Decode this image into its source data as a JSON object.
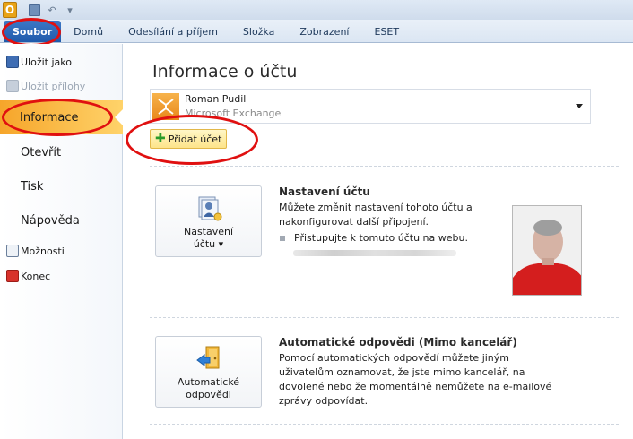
{
  "ribbon": {
    "tabs": [
      {
        "label": "Soubor"
      },
      {
        "label": "Domů"
      },
      {
        "label": "Odesílání a příjem"
      },
      {
        "label": "Složka"
      },
      {
        "label": "Zobrazení"
      },
      {
        "label": "ESET"
      }
    ]
  },
  "qat": {
    "app_icon": "outlook-icon"
  },
  "nav": {
    "items": [
      {
        "label": "Uložit jako",
        "icon": "save-as-icon"
      },
      {
        "label": "Uložit přílohy",
        "icon": "save-attachments-icon"
      },
      {
        "label": "Informace"
      },
      {
        "label": "Otevřít"
      },
      {
        "label": "Tisk"
      },
      {
        "label": "Nápověda"
      },
      {
        "label": "Možnosti",
        "icon": "options-icon"
      },
      {
        "label": "Konec",
        "icon": "exit-icon"
      }
    ]
  },
  "content": {
    "title": "Informace o účtu",
    "account": {
      "name": "Roman Pudil",
      "type": "Microsoft Exchange"
    },
    "add_account_label": "Přidat účet",
    "settings": {
      "button_line1": "Nastavení",
      "button_line2": "účtu ▾",
      "title": "Nastavení účtu",
      "text": "Můžete změnit nastavení tohoto účtu a nakonfigurovat další připojení.",
      "bullet": "Přistupujte k tomuto účtu na webu."
    },
    "auto_reply": {
      "button_line1": "Automatické",
      "button_line2": "odpovědi",
      "title": "Automatické odpovědi (Mimo kancelář)",
      "text": "Pomocí automatických odpovědí můžete jiným uživatelům oznamovat, že jste mimo kancelář, na dovolené nebo že momentálně nemůžete na e-mailové zprávy odpovídat."
    }
  },
  "colors": {
    "file_tab": "#2a66b8",
    "selected_nav": "#f8b33e",
    "annotation_circle": "#e01010"
  }
}
